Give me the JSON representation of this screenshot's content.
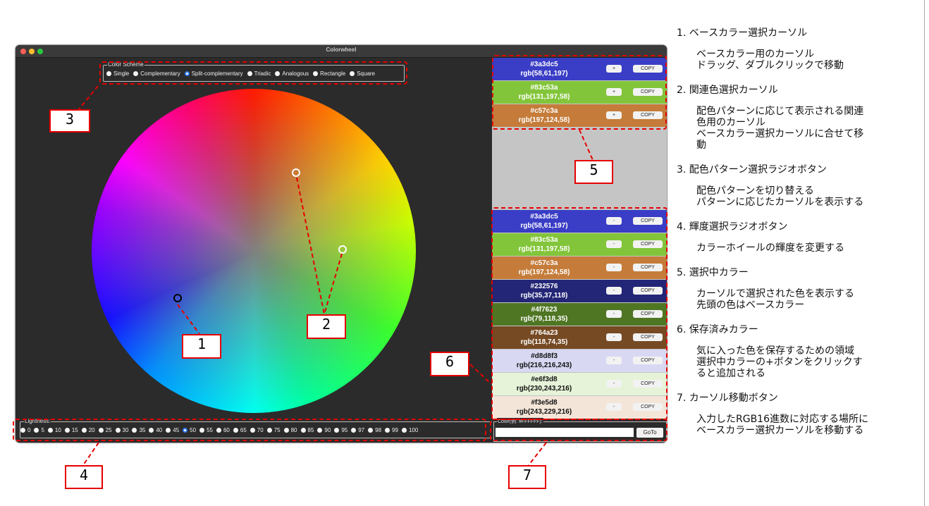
{
  "window": {
    "title": "Colorwheel"
  },
  "scheme": {
    "legend": "Color Scheme",
    "options": [
      "Single",
      "Complementary",
      "Split-complementary",
      "Triadic",
      "Analogous",
      "Rectangle",
      "Square"
    ],
    "selected": "Split-complementary"
  },
  "lightness": {
    "legend": "Lightness:",
    "options": [
      "0",
      "5",
      "10",
      "15",
      "20",
      "25",
      "30",
      "35",
      "40",
      "45",
      "50",
      "55",
      "60",
      "65",
      "70",
      "75",
      "80",
      "85",
      "90",
      "95",
      "97",
      "98",
      "99",
      "100"
    ],
    "selected": "50"
  },
  "selected_colors": [
    {
      "hex": "#3a3dc5",
      "rgb": "rgb(58,61,197)",
      "bg": "#3a3dc5"
    },
    {
      "hex": "#83c53a",
      "rgb": "rgb(131,197,58)",
      "bg": "#83c53a"
    },
    {
      "hex": "#c57c3a",
      "rgb": "rgb(197,124,58)",
      "bg": "#c57c3a"
    }
  ],
  "saved_colors": [
    {
      "hex": "#3a3dc5",
      "rgb": "rgb(58,61,197)",
      "bg": "#3a3dc5",
      "dark": false
    },
    {
      "hex": "#83c53a",
      "rgb": "rgb(131,197,58)",
      "bg": "#83c53a",
      "dark": false
    },
    {
      "hex": "#c57c3a",
      "rgb": "rgb(197,124,58)",
      "bg": "#c57c3a",
      "dark": false
    },
    {
      "hex": "#232576",
      "rgb": "rgb(35,37,118)",
      "bg": "#232576",
      "dark": false
    },
    {
      "hex": "#4f7623",
      "rgb": "rgb(79,118,35)",
      "bg": "#4f7623",
      "dark": false
    },
    {
      "hex": "#764a23",
      "rgb": "rgb(118,74,35)",
      "bg": "#764a23",
      "dark": false
    },
    {
      "hex": "#d8d8f3",
      "rgb": "rgb(216,216,243)",
      "bg": "#d8d8f3",
      "dark": true
    },
    {
      "hex": "#e6f3d8",
      "rgb": "rgb(230,243,216)",
      "bg": "#e6f3d8",
      "dark": true
    },
    {
      "hex": "#f3e5d8",
      "rgb": "rgb(243,229,216)",
      "bg": "#f3e5d8",
      "dark": true
    }
  ],
  "buttons": {
    "plus": "+",
    "minus": "-",
    "copy": "COPY",
    "goto": "GoTo"
  },
  "color_input": {
    "legend": "Color(例: #FFFFFF):",
    "value": ""
  },
  "callout_numbers": [
    "1",
    "2",
    "3",
    "4",
    "5",
    "6",
    "7"
  ],
  "descriptions": [
    {
      "title": "1.  ベースカラー選択カーソル",
      "desc": "ベースカラー用のカーソル\nドラッグ、ダブルクリックで移動"
    },
    {
      "title": "2.  関連色選択カーソル",
      "desc": "配色パターンに応じて表示される関連\n色用のカーソル\nベースカラー選択カーソルに合せて移\n動"
    },
    {
      "title": "3.  配色パターン選択ラジオボタン",
      "desc": "配色パターンを切り替える\nパターンに応じたカーソルを表示する"
    },
    {
      "title": "4.  輝度選択ラジオボタン",
      "desc": "カラーホイールの輝度を変更する"
    },
    {
      "title": "5.  選択中カラー",
      "desc": "カーソルで選択された色を表示する\n先頭の色はベースカラー"
    },
    {
      "title": "6.  保存済みカラー",
      "desc": "気に入った色を保存するための領域\n選択中カラーの+ボタンをクリックす\nると追加される"
    },
    {
      "title": "7.  カーソル移動ボタン",
      "desc": "入力したRGB16進数に対応する場所に\nベースカラー選択カーソルを移動する"
    }
  ],
  "colors": {
    "annotation": "#e60000",
    "window_bg": "#2b2b2b",
    "panel_bg": "#c5c5c5",
    "radio_selected": "#2f7bf5"
  }
}
